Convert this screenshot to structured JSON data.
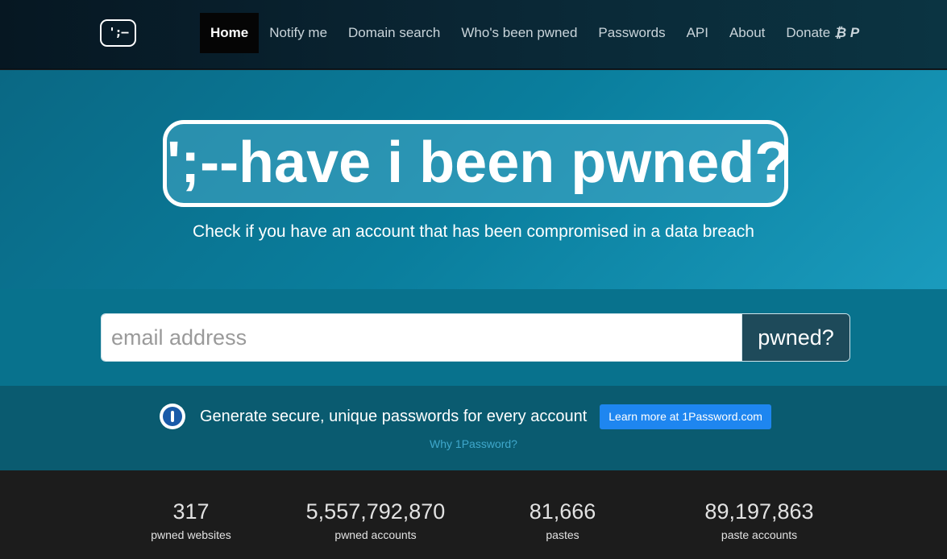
{
  "navbar": {
    "logo_text": "';–",
    "items": [
      {
        "label": "Home",
        "active": true
      },
      {
        "label": "Notify me"
      },
      {
        "label": "Domain search"
      },
      {
        "label": "Who's been pwned"
      },
      {
        "label": "Passwords"
      },
      {
        "label": "API"
      },
      {
        "label": "About"
      },
      {
        "label": "Donate",
        "symbols": "₿ P"
      }
    ]
  },
  "hero": {
    "title": "';--have i been pwned?",
    "subtitle": "Check if you have an account that has been compromised in a data breach"
  },
  "search": {
    "placeholder": "email address",
    "button_label": "pwned?"
  },
  "promo": {
    "icon": "1password-icon",
    "text": "Generate secure, unique passwords for every account",
    "button_label": "Learn more at 1Password.com",
    "link_label": "Why 1Password?"
  },
  "stats": [
    {
      "value": "317",
      "label": "pwned websites"
    },
    {
      "value": "5,557,792,870",
      "label": "pwned accounts"
    },
    {
      "value": "81,666",
      "label": "pastes"
    },
    {
      "value": "89,197,863",
      "label": "paste accounts"
    }
  ],
  "colors": {
    "accent_button": "#1e86f0",
    "search_button": "#1e4a5a",
    "hero_bg": "#0a7e9d"
  }
}
